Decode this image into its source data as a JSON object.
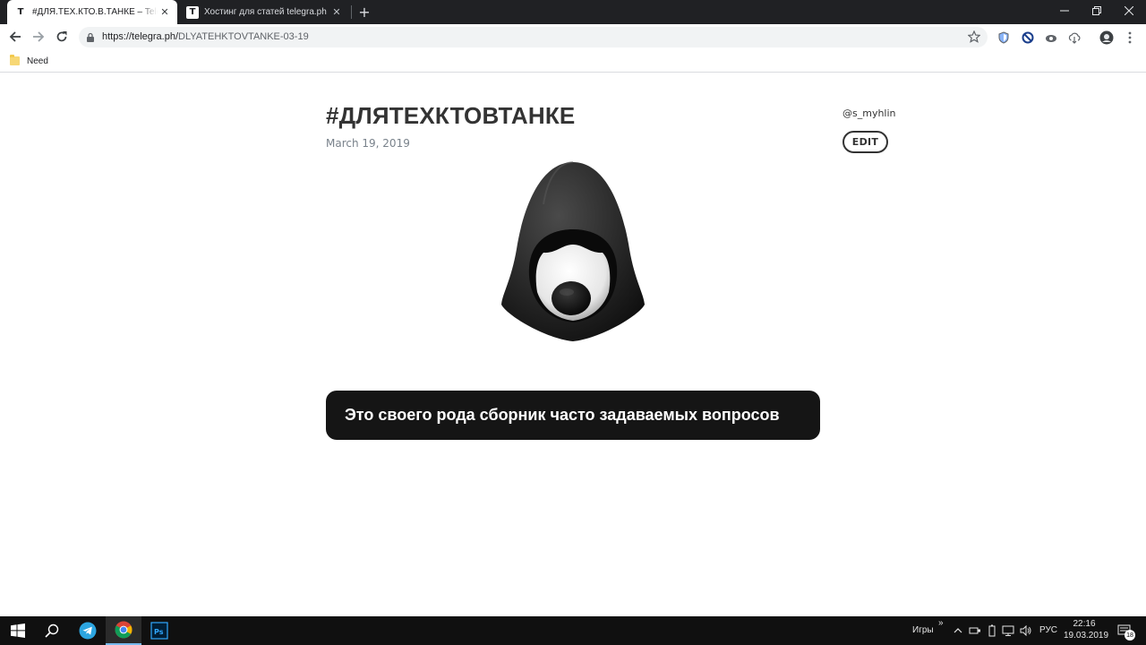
{
  "browser": {
    "tabs": [
      {
        "favicon": "T",
        "title": "#ДЛЯ.ТЕХ.КТО.В.ТАНКЕ – Telegraph",
        "active": true
      },
      {
        "favicon": "T",
        "title": "Хостинг для статей telegra.ph",
        "active": false
      }
    ],
    "address": {
      "host": "https://telegra.ph/",
      "path": "DLYATEHKTOVTANKE-03-19"
    },
    "bookmarks": [
      {
        "label": "Need",
        "icon": "folder-icon"
      }
    ]
  },
  "article": {
    "title": "#ДЛЯТЕХКТОВТАНКЕ",
    "date": "March 19, 2019",
    "author": "@s_myhlin",
    "edit_label": "EDIT",
    "caption": "Это своего рода сборник часто задаваемых вопросов"
  },
  "taskbar": {
    "apps": [
      {
        "name": "telegram-icon",
        "active": false
      },
      {
        "name": "chrome-icon",
        "active": true
      },
      {
        "name": "photoshop-icon",
        "active": false,
        "label": "Ps"
      }
    ],
    "games_label": "Игры",
    "language": "РУС",
    "time": "22:16",
    "date": "19.03.2019",
    "notification_count": "18"
  },
  "colors": {
    "chrome_dark": "#202124",
    "caption_bg": "#151515",
    "title_text": "#333333",
    "date_text": "#79828b",
    "taskbar_bg": "#101010"
  }
}
